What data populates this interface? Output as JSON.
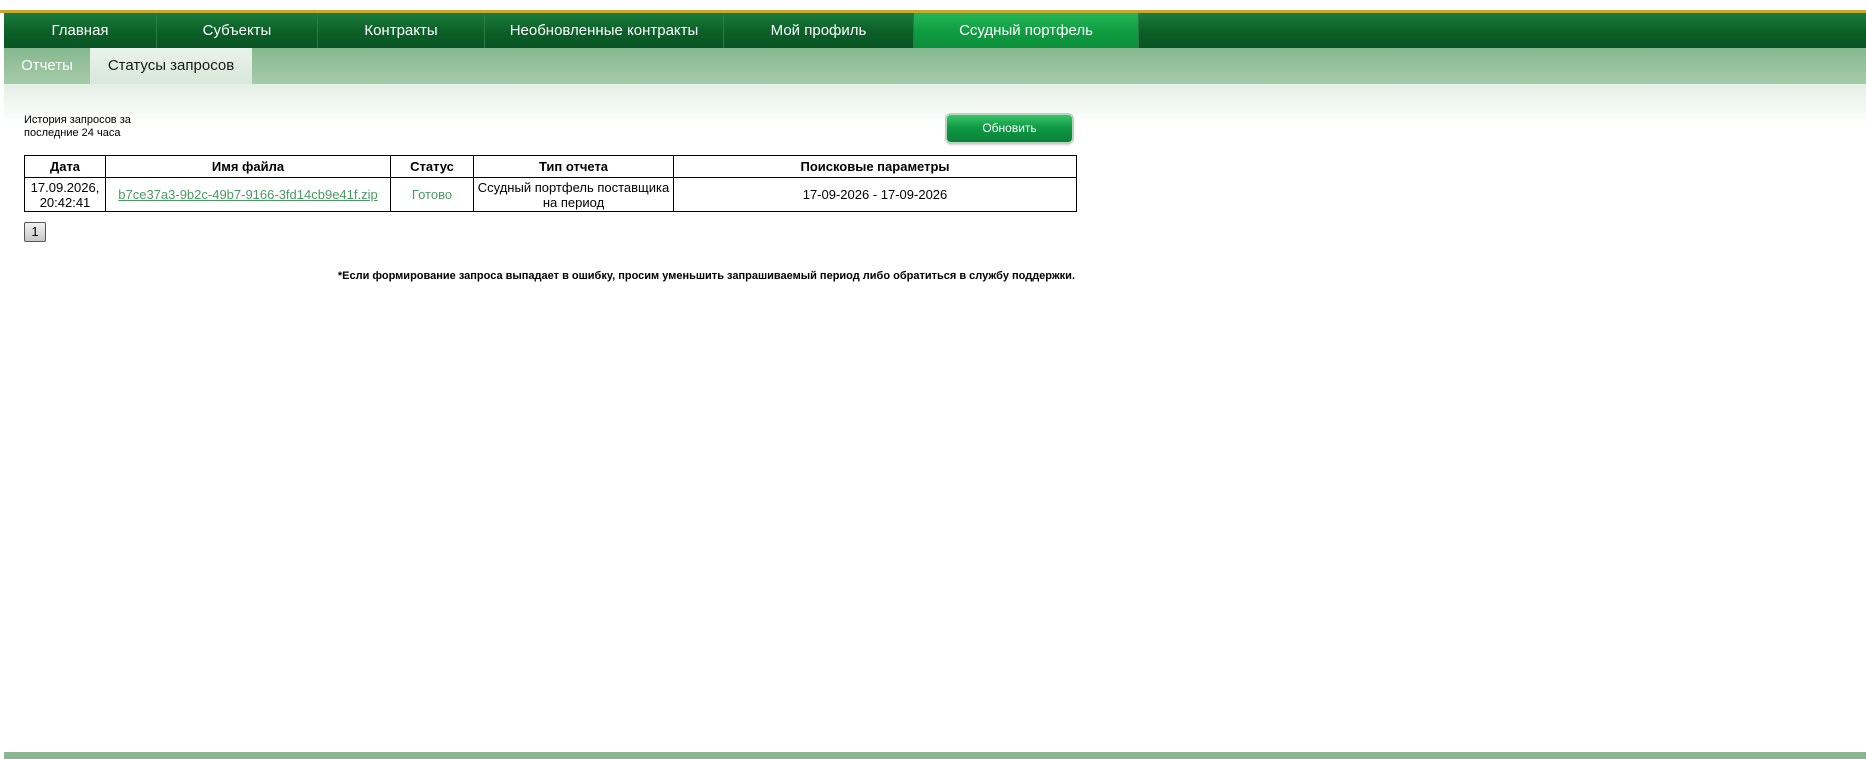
{
  "main_nav": {
    "items": [
      {
        "label": "Главная"
      },
      {
        "label": "Субъекты"
      },
      {
        "label": "Контракты"
      },
      {
        "label": "Необновленные контракты"
      },
      {
        "label": "Мой профиль"
      },
      {
        "label": "Ссудный портфель"
      }
    ],
    "active": "Ссудный портфель"
  },
  "sub_nav": {
    "tabs": [
      {
        "label": "Отчеты"
      },
      {
        "label": "Статусы запросов"
      }
    ],
    "active": "Статусы запросов"
  },
  "history_label": "История запросов за последние 24 часа",
  "refresh_button": "Обновить",
  "table": {
    "columns": [
      "Дата",
      "Имя файла",
      "Статус",
      "Тип отчета",
      "Поисковые параметры"
    ],
    "rows": [
      {
        "date": "17.09.2026, 20:42:41",
        "file": "b7ce37a3-9b2c-49b7-9166-3fd14cb9e41f.zip",
        "status": "Готово",
        "report_type": "Ссудный портфель поставщика на период",
        "params": "17-09-2026 - 17-09-2026"
      }
    ]
  },
  "pagination": {
    "current_page": "1"
  },
  "footnote": "*Если формирование запроса выпадает в ошибку, просим уменьшить запрашиваемый период либо обратиться в службу поддержки.",
  "colors": {
    "nav_dark_green": "#0b5f27",
    "nav_active_green": "#0e9a40",
    "subnav_green": "#86b88f",
    "link_green": "#4a9a62",
    "gold_line": "#c9a832"
  }
}
